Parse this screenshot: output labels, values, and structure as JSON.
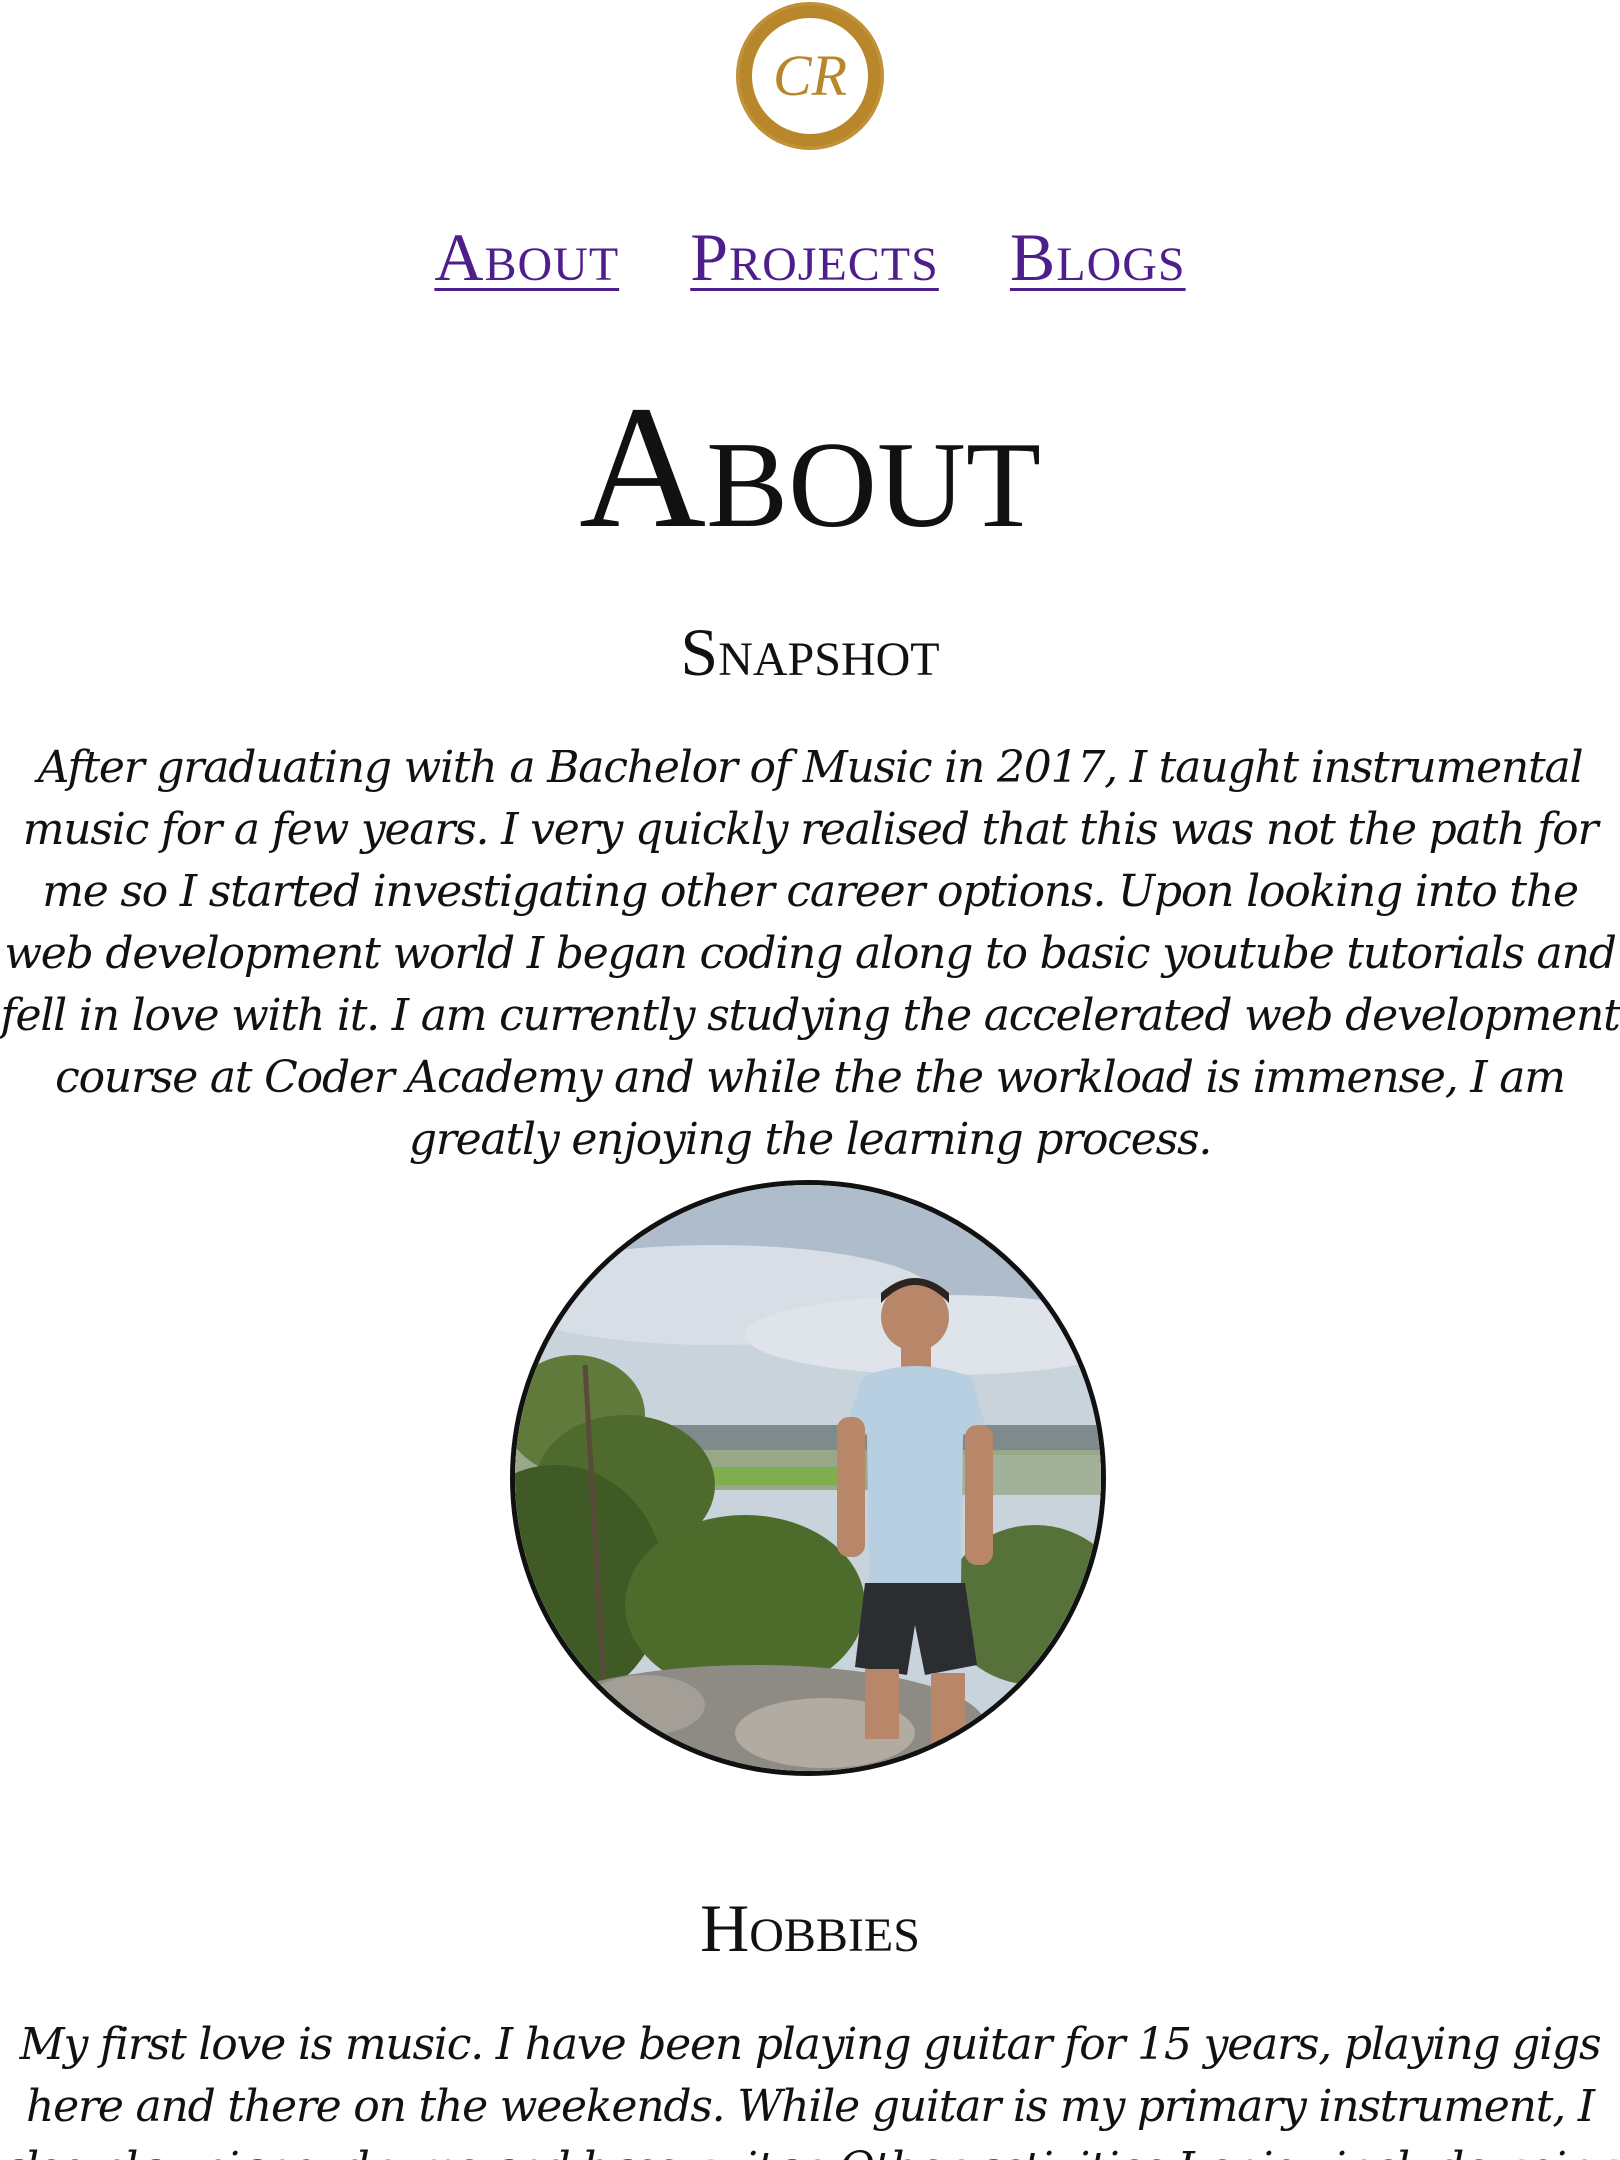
{
  "brand": {
    "logo_text": "CR",
    "logo_color": "#b8862b"
  },
  "nav": {
    "items": [
      {
        "label": "About"
      },
      {
        "label": "Projects"
      },
      {
        "label": "Blogs"
      }
    ],
    "link_color": "#4e1f8c"
  },
  "page": {
    "title": "About"
  },
  "snapshot": {
    "heading": "Snapshot",
    "text": "After graduating with a Bachelor of Music in 2017, I taught instrumental music for a few years. I very quickly realised that this was not the path for me so I started investigating other career options. Upon looking into the web development world I began coding along to basic youtube tutorials and fell in love with it. I am currently studying the accelerated web development course at Coder Academy and while the the workload is immense, I am greatly enjoying the learning process."
  },
  "photo": {
    "subject": "man standing on a rocky lookout above a green valley"
  },
  "hobbies": {
    "heading": "Hobbies",
    "text": "My first love is music. I have been playing guitar for 15 years, playing gigs here and there on the weekends. While guitar is my primary instrument, I also play piano, drums and bass guitar. Other activities I enjoy include going to the gym, reading"
  }
}
